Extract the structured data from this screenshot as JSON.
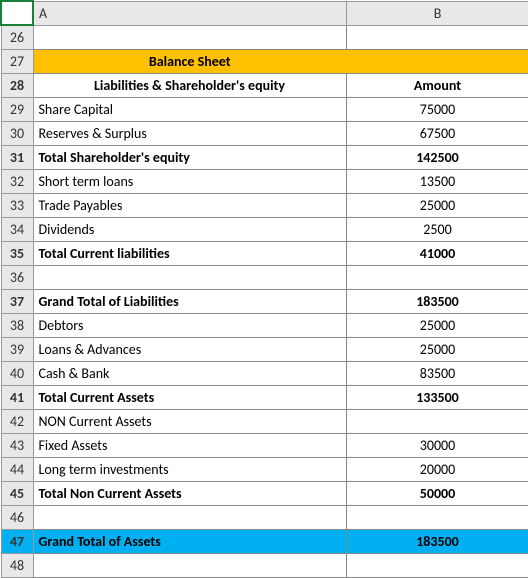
{
  "columns": {
    "rowHeader": "",
    "A": "A",
    "B": "B"
  },
  "title": "Balance Sheet",
  "header": {
    "label": "Liabilities & Shareholder's equity",
    "amount": "Amount"
  },
  "rows": [
    {
      "num": "26",
      "a": "",
      "b": "",
      "cls": ""
    },
    {
      "num": "27",
      "a": "Balance Sheet",
      "b": "",
      "cls": "title-row",
      "merge": true
    },
    {
      "num": "28",
      "a": "Liabilities & Shareholder's equity",
      "b": "Amount",
      "cls": "header-row"
    },
    {
      "num": "29",
      "a": "Share Capital",
      "b": "75000",
      "cls": ""
    },
    {
      "num": "30",
      "a": "Reserves & Surplus",
      "b": "67500",
      "cls": ""
    },
    {
      "num": "31",
      "a": "Total Shareholder's equity",
      "b": "142500",
      "cls": "bold"
    },
    {
      "num": "32",
      "a": "Short term loans",
      "b": "13500",
      "cls": ""
    },
    {
      "num": "33",
      "a": "Trade Payables",
      "b": "25000",
      "cls": ""
    },
    {
      "num": "34",
      "a": "Dividends",
      "b": "2500",
      "cls": ""
    },
    {
      "num": "35",
      "a": "Total Current liabilities",
      "b": "41000",
      "cls": "bold"
    },
    {
      "num": "36",
      "a": "",
      "b": "",
      "cls": ""
    },
    {
      "num": "37",
      "a": "Grand Total of Liabilities",
      "b": "183500",
      "cls": "bold"
    },
    {
      "num": "38",
      "a": "Debtors",
      "b": "25000",
      "cls": ""
    },
    {
      "num": "39",
      "a": "Loans & Advances",
      "b": "25000",
      "cls": ""
    },
    {
      "num": "40",
      "a": "Cash & Bank",
      "b": "83500",
      "cls": ""
    },
    {
      "num": "41",
      "a": "Total Current Assets",
      "b": "133500",
      "cls": "bold"
    },
    {
      "num": "42",
      "a": "NON Current Assets",
      "b": "",
      "cls": ""
    },
    {
      "num": "43",
      "a": "Fixed Assets",
      "b": "30000",
      "cls": ""
    },
    {
      "num": "44",
      "a": "Long term investments",
      "b": "20000",
      "cls": ""
    },
    {
      "num": "45",
      "a": "Total Non Current Assets",
      "b": "50000",
      "cls": "bold"
    },
    {
      "num": "46",
      "a": "",
      "b": "",
      "cls": ""
    },
    {
      "num": "47",
      "a": "Grand Total of Assets",
      "b": "183500",
      "cls": "grand-assets"
    },
    {
      "num": "48",
      "a": "",
      "b": "",
      "cls": ""
    }
  ],
  "chart_data": {
    "type": "table",
    "title": "Balance Sheet",
    "columns": [
      "Liabilities & Shareholder's equity",
      "Amount"
    ],
    "data": [
      [
        "Share Capital",
        75000
      ],
      [
        "Reserves & Surplus",
        67500
      ],
      [
        "Total Shareholder's equity",
        142500
      ],
      [
        "Short term loans",
        13500
      ],
      [
        "Trade Payables",
        25000
      ],
      [
        "Dividends",
        2500
      ],
      [
        "Total Current liabilities",
        41000
      ],
      [
        "Grand Total of Liabilities",
        183500
      ],
      [
        "Debtors",
        25000
      ],
      [
        "Loans & Advances",
        25000
      ],
      [
        "Cash & Bank",
        83500
      ],
      [
        "Total Current Assets",
        133500
      ],
      [
        "NON Current Assets",
        null
      ],
      [
        "Fixed Assets",
        30000
      ],
      [
        "Long term investments",
        20000
      ],
      [
        "Total Non Current Assets",
        50000
      ],
      [
        "Grand Total of Assets",
        183500
      ]
    ]
  }
}
